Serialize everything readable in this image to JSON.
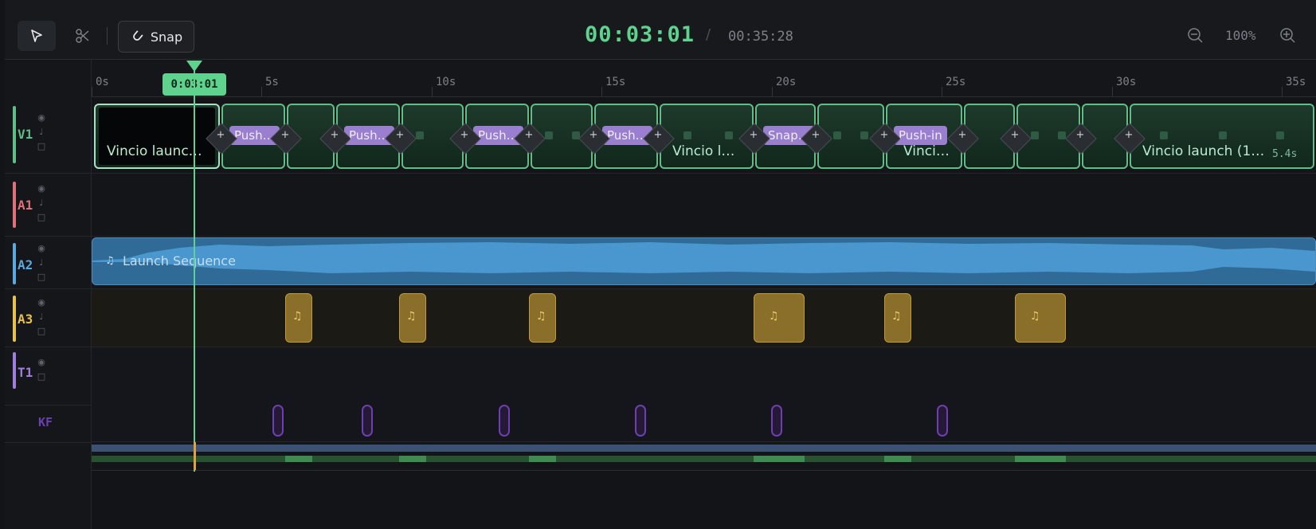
{
  "toolbar": {
    "snap_label": "Snap",
    "timecode_current": "00:03:01",
    "timecode_separator": "/",
    "timecode_total": "00:35:28",
    "zoom_level": "100%"
  },
  "ruler": {
    "labels": [
      "0s",
      "5s",
      "10s",
      "15s",
      "20s",
      "25s",
      "30s",
      "35s"
    ],
    "playhead_time": "0:03:01"
  },
  "tracks": [
    {
      "id": "V1",
      "color": "#5fbe86"
    },
    {
      "id": "A1",
      "color": "#e0707a"
    },
    {
      "id": "A2",
      "color": "#5aa9e0"
    },
    {
      "id": "A3",
      "color": "#e8c04a"
    },
    {
      "id": "T1",
      "color": "#a07ee0"
    },
    {
      "id": "KF",
      "color": "#6d3fb0"
    }
  ],
  "video_clips": {
    "first_label": "Vincio launc…",
    "mid_label": "Vincio l…",
    "mid2_label": "Vinci…",
    "last_label": "Vincio launch (1…",
    "last_duration": "5.4s"
  },
  "transitions": [
    "Push…",
    "Push…",
    "Push…",
    "Push…",
    "Snap…",
    "Push-in"
  ],
  "audio_clip": {
    "label": "Launch Sequence"
  },
  "colors": {
    "accent": "#5fd38d",
    "audio": "#2f6b96",
    "sfx": "#8a6f2b",
    "keyframe": "#6d3fb0"
  }
}
